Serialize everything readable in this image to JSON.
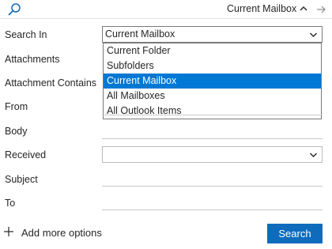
{
  "topbar": {
    "scope_label": "Current Mailbox",
    "icons": [
      "search-icon",
      "chevron-up-icon",
      "arrow-right-icon"
    ]
  },
  "form": {
    "search_in_label": "Search In",
    "search_in_value": "Current Mailbox",
    "attachments_label": "Attachments",
    "attachment_contains_label": "Attachment Contains",
    "from_label": "From",
    "body_label": "Body",
    "received_label": "Received",
    "subject_label": "Subject",
    "to_label": "To"
  },
  "dropdown": {
    "options": [
      "Current Folder",
      "Subfolders",
      "Current Mailbox",
      "All Mailboxes",
      "All Outlook Items"
    ],
    "selected": "Current Mailbox"
  },
  "footer": {
    "add_more_label": "Add more options",
    "search_button": "Search"
  },
  "colors": {
    "accent": "#0078d4",
    "button": "#0f6cbd"
  }
}
